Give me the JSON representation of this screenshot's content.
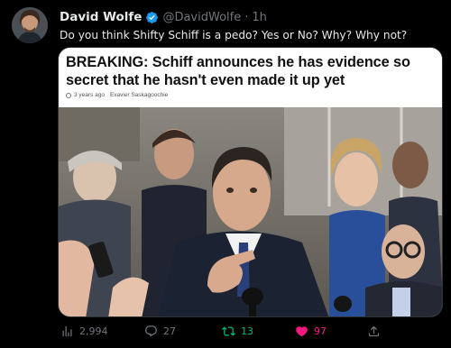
{
  "author": {
    "display_name": "David Wolfe",
    "handle": "@DavidWolfe",
    "separator": "·",
    "time": "1h",
    "verified": true
  },
  "tweet": {
    "text": "Do you think Shifty Schiff is a pedo? Yes or No? Why? Why not?"
  },
  "media": {
    "headline_line1": "BREAKING: Schiff announces he has evidence so",
    "headline_line2": "secret that he hasn't even made it up yet",
    "meta_age": "3 years ago",
    "meta_author": "Exavier Saskagoochie"
  },
  "actions": {
    "views": "2,994",
    "replies": "27",
    "retweets": "13",
    "likes": "97"
  },
  "colors": {
    "background": "#000000",
    "text": "#e7e9ea",
    "muted": "#71767b",
    "verified": "#1d9bf0",
    "retweet_active": "#00ba7c",
    "like_active": "#f91880"
  },
  "icons": [
    "verified-badge-icon",
    "views-icon",
    "reply-icon",
    "retweet-icon",
    "like-icon",
    "share-icon",
    "clock-icon"
  ]
}
